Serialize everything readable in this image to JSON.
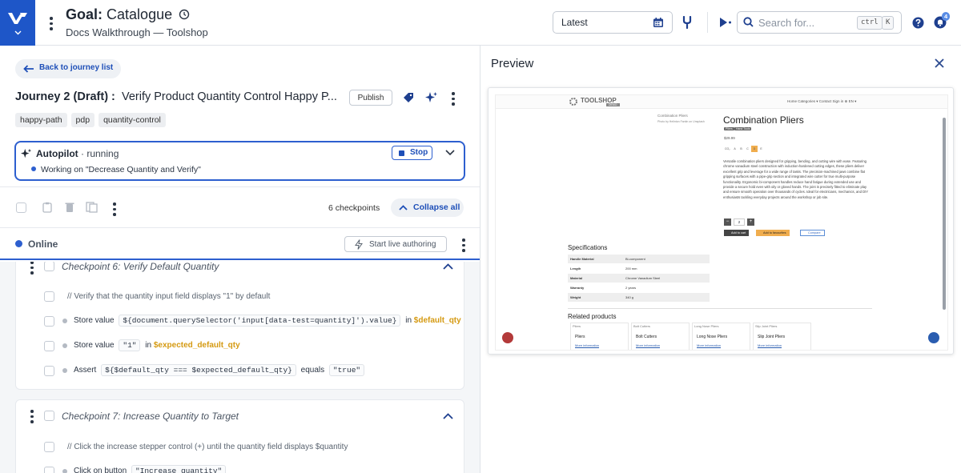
{
  "header": {
    "goal_prefix": "Goal:",
    "goal_name": "Catalogue",
    "subtitle": "Docs Walkthrough — Toolshop",
    "version_select": "Latest",
    "search_placeholder": "Search for...",
    "kbd_ctrl": "ctrl",
    "kbd_k": "K",
    "notification_count": "4"
  },
  "journey": {
    "back_label": "Back to journey list",
    "prefix": "Journey 2 (Draft) :",
    "name": "Verify Product Quantity Control Happy P...",
    "publish_label": "Publish",
    "tags": [
      "happy-path",
      "pdp",
      "quantity-control"
    ]
  },
  "autopilot": {
    "label": "Autopilot",
    "status": "· running",
    "working_on": "Working on \"Decrease Quantity and Verify\"",
    "stop_label": "Stop"
  },
  "toolbar": {
    "checkpoint_count": "6 checkpoints",
    "collapse_label": "Collapse all"
  },
  "status": {
    "online_label": "Online",
    "live_label": "Start live authoring"
  },
  "checkpoints": [
    {
      "title": "Checkpoint 6:  Verify Default Quantity",
      "comment": "// Verify that the quantity input field displays \"1\" by default",
      "steps": [
        {
          "action": "Store value",
          "code": "${document.querySelector('input[data-test=quantity]').value}",
          "joiner": "in",
          "var": "$default_qty"
        },
        {
          "action": "Store value",
          "code": "\"1\"",
          "joiner": "in",
          "var": "$expected_default_qty"
        },
        {
          "action": "Assert",
          "code": "${$default_qty === $expected_default_qty}",
          "joiner": "equals",
          "code2": "\"true\""
        }
      ]
    },
    {
      "title": "Checkpoint 7:  Increase Quantity to Target",
      "comment": "// Click the increase stepper control (+) until the quantity field displays $quantity",
      "steps": [
        {
          "action": "Click on button",
          "code": "\"Increase quantity\""
        }
      ]
    }
  ],
  "preview": {
    "title": "Preview",
    "shop": {
      "brand": "TOOLSHOP",
      "brand_sub": "DEMO",
      "nav": "Home   Categories ▾   Contact   Sign in   ⊕ EN ▾",
      "image_alt": "Combination Pliers",
      "photo_credit": "Photo by Helinton Fantin on Unsplash",
      "product_name": "Combination Pliers",
      "badges": [
        "Pliers",
        "Hand Tools"
      ],
      "price": "$29.99",
      "co2_label": "CO₂",
      "co2_grades": [
        "A",
        "B",
        "C",
        "D",
        "E"
      ],
      "co2_active": "D",
      "description": "Versatile combination pliers designed for gripping, bending, and cutting wire with ease. Featuring chrome vanadium steel construction with induction-hardened cutting edges, these pliers deliver excellent grip and leverage for a wide range of tasks. The precision-machined jaws combine flat gripping surfaces with a pipe-grip section and integrated wire cutter for true multi-purpose functionality. Ergonomic bi-component handles reduce hand fatigue during extended use and provide a secure hold even with oily or gloved hands. The joint is precisely fitted to eliminate play and ensure smooth operation over thousands of cycles. Ideal for electricians, mechanics, and DIY enthusiasts tackling everyday projects around the workshop or job site.",
      "qty_value": "2",
      "qty_minus": "−",
      "qty_plus": "+",
      "add_to_cart": "Add to cart",
      "add_to_favourites": "Add to favourites",
      "compare": "Compare",
      "specs_title": "Specifications",
      "specs": [
        {
          "k": "Handle Material",
          "v": "Bi-component"
        },
        {
          "k": "Length",
          "v": "200 mm"
        },
        {
          "k": "Material",
          "v": "Chrome Vanadium Steel"
        },
        {
          "k": "Warranty",
          "v": "2 years"
        },
        {
          "k": "Weight",
          "v": "340 g"
        }
      ],
      "related_title": "Related products",
      "related": [
        {
          "img": "Pliers",
          "name": "Pliers",
          "link": "More information"
        },
        {
          "img": "Bolt Cutters",
          "name": "Bolt Cutters",
          "link": "More information"
        },
        {
          "img": "Long Nose Pliers",
          "name": "Long Nose Pliers",
          "link": "More information"
        },
        {
          "img": "Slip Joint Pliers",
          "name": "Slip Joint Pliers",
          "link": "More information"
        }
      ]
    }
  },
  "colors": {
    "brand": "#1e56c8",
    "accent": "#2d5fcf",
    "variable": "#d59a12",
    "shop_accent": "#f0ad4e"
  }
}
